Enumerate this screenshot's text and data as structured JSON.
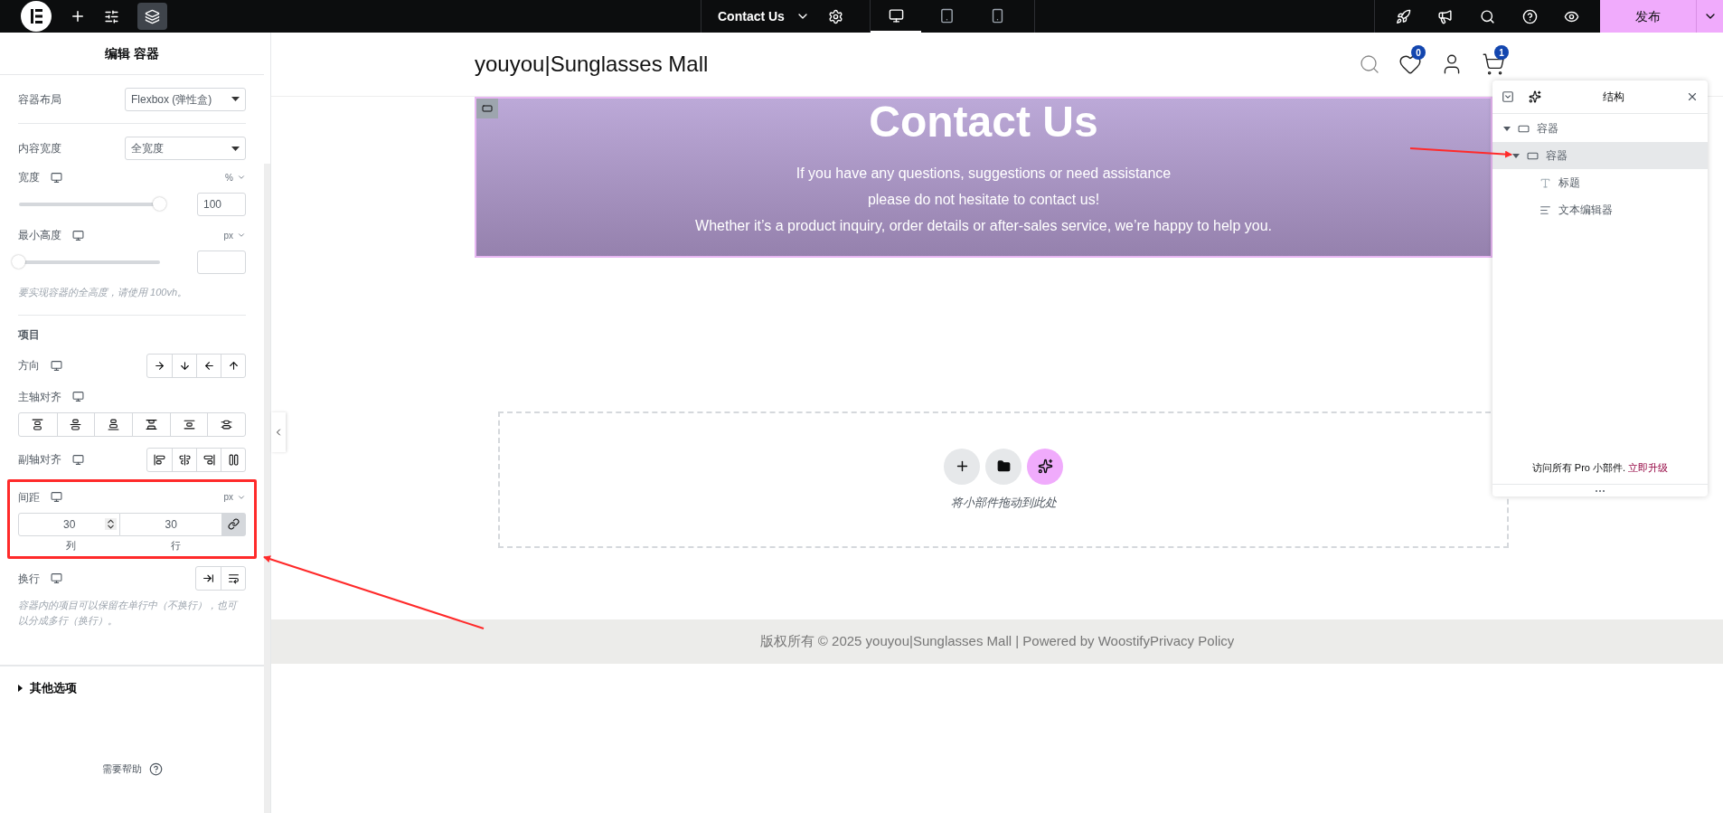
{
  "topbar": {
    "page_title": "Contact Us",
    "publish": "发布",
    "devices": [
      {
        "kind": "desktop",
        "selected": true
      },
      {
        "kind": "tablet",
        "selected": false
      },
      {
        "kind": "mobile",
        "selected": false
      }
    ]
  },
  "panel": {
    "title": "编辑 容器",
    "layout": {
      "label": "容器布局",
      "value": "Flexbox (弹性盒)"
    },
    "content_width": {
      "label": "内容宽度",
      "value": "全宽度"
    },
    "width": {
      "label": "宽度",
      "unit": "%",
      "level": 1,
      "value": "100"
    },
    "min_height": {
      "label": "最小高度",
      "unit": "px",
      "level": 0,
      "hint": "要实现容器的全高度，请使用 100vh。"
    },
    "items_heading": "项目",
    "direction": {
      "label": "方向"
    },
    "justify": {
      "label": "主轴对齐"
    },
    "align": {
      "label": "副轴对齐"
    },
    "gap": {
      "label": "间距",
      "unit": "px",
      "column": "30",
      "row": "30",
      "column_label": "列",
      "row_label": "行",
      "linked": true
    },
    "wrap": {
      "label": "换行",
      "hint": "容器内的项目可以保留在单行中（不换行），也可以分成多行（换行）。"
    },
    "other_options": "其他选项",
    "help": "需要帮助"
  },
  "site": {
    "title": "youyou|Sunglasses Mall",
    "wishlist_count": "0",
    "cart_count": "1",
    "hero": {
      "heading": "Contact Us",
      "lines": [
        "If you have any questions, suggestions or need assistance",
        "please do not hesitate to contact us!",
        "Whether it’s a product inquiry, order details or after-sales service, we’re happy to help you."
      ]
    },
    "drop_hint": "将小部件拖动到此处",
    "footer": "版权所有 © 2025 youyou|Sunglasses Mall | Powered by WoostifyPrivacy Policy"
  },
  "structure": {
    "title": "结构",
    "tree": [
      {
        "label": "容器",
        "kind": "container",
        "expanded": true,
        "selected": false,
        "children": [
          {
            "label": "容器",
            "kind": "container",
            "expanded": true,
            "selected": true,
            "children": [
              {
                "label": "标题",
                "kind": "heading",
                "selected": false
              },
              {
                "label": "文本编辑器",
                "kind": "text",
                "selected": false
              }
            ]
          }
        ]
      }
    ],
    "promo": "访问所有 Pro 小部件.",
    "upgrade": "立即升级"
  }
}
